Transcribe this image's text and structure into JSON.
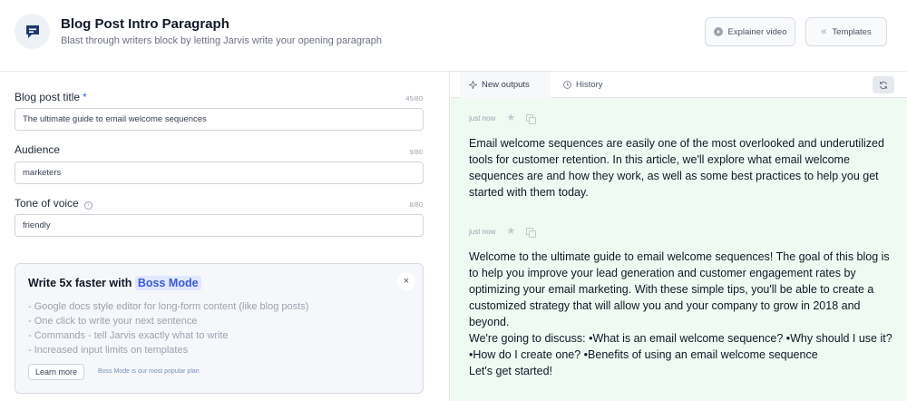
{
  "header": {
    "title": "Blog Post Intro Paragraph",
    "subtitle": "Blast through writers block by letting Jarvis write your opening paragraph",
    "explainer_label": "Explainer video",
    "templates_label": "Templates"
  },
  "form": {
    "fields": [
      {
        "label": "Blog post title",
        "required_mark": "*",
        "counter": "45/80",
        "value": "The ultimate guide to email welcome sequences"
      },
      {
        "label": "Audience",
        "counter": "9/80",
        "value": "marketers"
      },
      {
        "label": "Tone of voice",
        "counter": "8/80",
        "value": "friendly"
      }
    ]
  },
  "boss": {
    "title_prefix": "Write 5x faster with",
    "title_highlight": "Boss Mode",
    "close_label": "×",
    "features": [
      "- Google docs style editor for long-form content (like blog posts)",
      "- One click to write your next sentence",
      "- Commands - tell Jarvis exactly what to write",
      "- Increased input limits on templates"
    ],
    "learn_more_label": "Learn more",
    "note": "Boss Mode is our most popular plan"
  },
  "outputs_panel": {
    "tabs": [
      "New outputs",
      "History"
    ],
    "outputs": [
      {
        "time": "just now",
        "text": "Email welcome sequences are easily one of the most overlooked and underutilized tools for customer retention. In this article, we'll explore what email welcome sequences are and how they work, as well as some best practices to help you get started with them today."
      },
      {
        "time": "just now",
        "text": "Welcome to the ultimate guide to email welcome sequences! The goal of this blog is to help you improve your lead generation and customer engagement rates by optimizing your email marketing. With these simple tips, you'll be able to create a customized strategy that will allow you and your company to grow in 2018 and beyond.\nWe're going to discuss:   •What is an email welcome sequence? •Why should I use it? •How do I create one? •Benefits of using an email welcome sequence\nLet's get started!"
      }
    ]
  },
  "colors": {
    "accent": "#3b5bdb",
    "output_bg": "#effaf2"
  }
}
